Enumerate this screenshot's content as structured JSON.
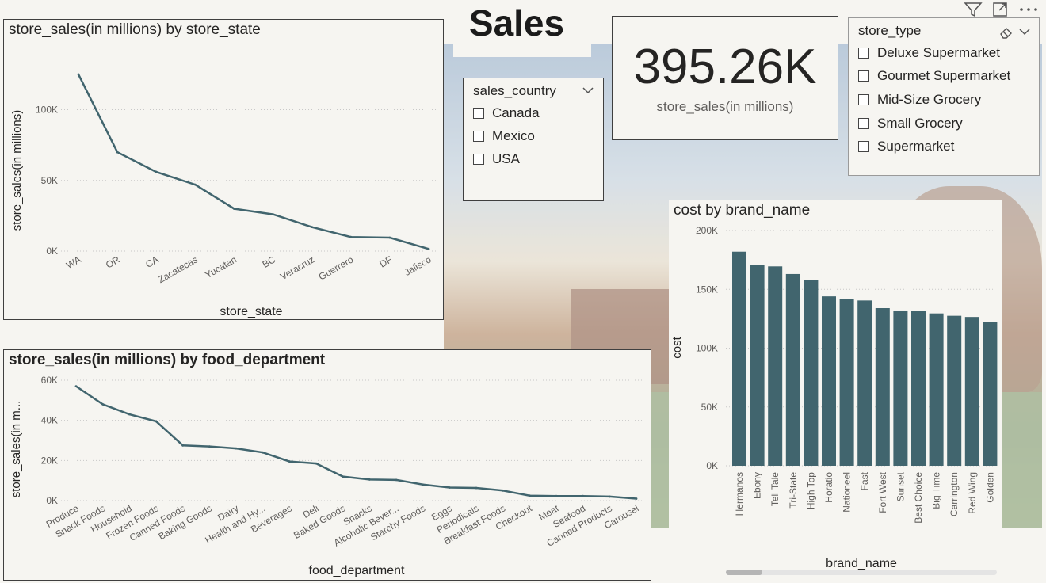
{
  "page": {
    "title": "Sales"
  },
  "toolbar": {
    "icons": [
      "filter-icon",
      "focus-mode-icon",
      "more-options-icon"
    ]
  },
  "colors": {
    "series": "#41656e",
    "panel_bg": "#f6f5f1",
    "grid": "#c8c8c8"
  },
  "card": {
    "value": "395.26K",
    "label": "store_sales(in millions)"
  },
  "sales_country_slicer": {
    "header": "sales_country",
    "items": [
      "Canada",
      "Mexico",
      "USA"
    ]
  },
  "store_type_slicer": {
    "header": "store_type",
    "items": [
      "Deluxe Supermarket",
      "Gourmet Supermarket",
      "Mid-Size Grocery",
      "Small Grocery",
      "Supermarket"
    ]
  },
  "chart_data": [
    {
      "id": "state",
      "type": "line",
      "title": "store_sales(in millions) by store_state",
      "xlabel": "store_state",
      "ylabel": "store_sales(in millions)",
      "yticks": [
        "0K",
        "50K",
        "100K"
      ],
      "ylim": [
        0,
        130000
      ],
      "categories": [
        "WA",
        "OR",
        "CA",
        "Zacatecas",
        "Yucatan",
        "BC",
        "Veracruz",
        "Guerrero",
        "DF",
        "Jalisco"
      ],
      "values": [
        125000,
        70000,
        56000,
        47000,
        30000,
        26000,
        17000,
        10000,
        9500,
        1500
      ]
    },
    {
      "id": "dept",
      "type": "line",
      "title": "store_sales(in millions) by food_department",
      "xlabel": "food_department",
      "ylabel": "store_sales(in m...",
      "yticks": [
        "0K",
        "20K",
        "40K",
        "60K"
      ],
      "ylim": [
        0,
        60000
      ],
      "categories": [
        "Produce",
        "Snack Foods",
        "Household",
        "Frozen Foods",
        "Canned Foods",
        "Baking Goods",
        "Dairy",
        "Health and Hy...",
        "Beverages",
        "Deli",
        "Baked Goods",
        "Snacks",
        "Alcoholic Bever...",
        "Starchy Foods",
        "Eggs",
        "Periodicals",
        "Breakfast Foods",
        "Checkout",
        "Meat",
        "Seafood",
        "Canned Products",
        "Carousel"
      ],
      "values": [
        57000,
        48000,
        43000,
        39500,
        27500,
        27000,
        26000,
        24000,
        19500,
        18500,
        12000,
        10500,
        10300,
        8000,
        6500,
        6300,
        5000,
        2500,
        2300,
        2300,
        2000,
        1000
      ]
    },
    {
      "id": "brand",
      "type": "bar",
      "title": "cost by brand_name",
      "xlabel": "brand_name",
      "ylabel": "cost",
      "yticks": [
        "0K",
        "50K",
        "100K",
        "150K",
        "200K"
      ],
      "ylim": [
        0,
        200000
      ],
      "categories": [
        "Hermanos",
        "Ebony",
        "Tell Tale",
        "Tri-State",
        "High Top",
        "Horatio",
        "Nationeel",
        "Fast",
        "Fort West",
        "Sunset",
        "Best Choice",
        "Big Time",
        "Carrington",
        "Red Wing",
        "Golden"
      ],
      "values": [
        182000,
        171000,
        169500,
        163000,
        158000,
        144000,
        142000,
        140500,
        134000,
        132000,
        131500,
        129500,
        127500,
        126500,
        122000
      ]
    }
  ]
}
